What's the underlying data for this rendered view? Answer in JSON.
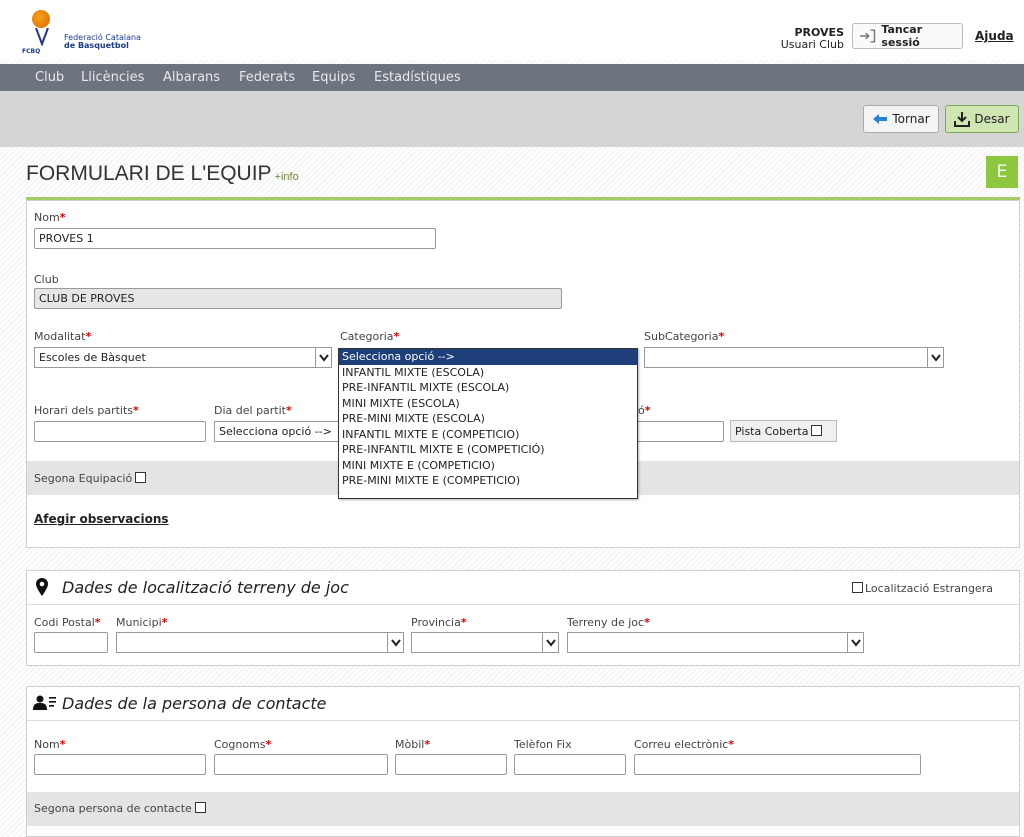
{
  "header": {
    "logo": {
      "line1": "Federació Catalana",
      "line2": "de Basquetbol",
      "abbr": "FCBQ"
    },
    "user": {
      "name": "PROVES",
      "role": "Usuari Club"
    },
    "logout_label": "Tancar sessió",
    "help_label": "Ajuda"
  },
  "menu": [
    "Club",
    "Llicències",
    "Albarans",
    "Federats",
    "Equips",
    "Estadístiques"
  ],
  "actions": {
    "back_label": "Tornar",
    "save_label": "Desar"
  },
  "page": {
    "title": "FORMULARI DE L'EQUIP",
    "info_link": "+info",
    "badge": "E"
  },
  "form": {
    "nom": {
      "label": "Nom",
      "value": "PROVES 1"
    },
    "club": {
      "label": "Club",
      "value": "CLUB DE PROVES"
    },
    "modalitat": {
      "label": "Modalitat",
      "value": "Escoles de Bàsquet"
    },
    "categoria": {
      "label": "Categoria",
      "value": "Selecciona opció -->"
    },
    "subcategoria": {
      "label": "SubCategoria",
      "value": ""
    },
    "horari": {
      "label": "Horari dels partits",
      "value": ""
    },
    "dia": {
      "label": "Dia del partit",
      "value": "Selecciona opció -->"
    },
    "equipacio_label_partial": "ó",
    "pista_coberta_label": "Pista Coberta",
    "segona_equipacio_label": "Segona Equipació",
    "afegir_observacions": "Afegir observacions"
  },
  "categoria_options": [
    "Selecciona opció -->",
    "INFANTIL MIXTE (ESCOLA)",
    "PRE-INFANTIL MIXTE (ESCOLA)",
    "MINI MIXTE (ESCOLA)",
    "PRE-MINI MIXTE (ESCOLA)",
    "INFANTIL MIXTE E (COMPETICIO)",
    "PRE-INFANTIL MIXTE E (COMPETICIÓ)",
    "MINI MIXTE E (COMPETICIO)",
    "PRE-MINI MIXTE E (COMPETICIO)"
  ],
  "localitzacio": {
    "title": "Dades de localització terreny de joc",
    "estrangera_label": "Localització Estrangera",
    "codi_postal": "Codi Postal",
    "municipi": "Municipi",
    "provincia": "Provincia",
    "terreny": "Terreny de joc"
  },
  "contacte": {
    "title": "Dades de la persona de contacte",
    "nom": "Nom",
    "cognoms": "Cognoms",
    "mobil": "Mòbil",
    "telefon": "Telèfon Fix",
    "correu": "Correu electrònic",
    "segona_persona": "Segona persona de contacte"
  },
  "colors": {
    "menu_bg": "#6d7480",
    "accent_green": "#8dc63f",
    "selected_option": "#1e3f7a",
    "required": "#dd0000"
  }
}
